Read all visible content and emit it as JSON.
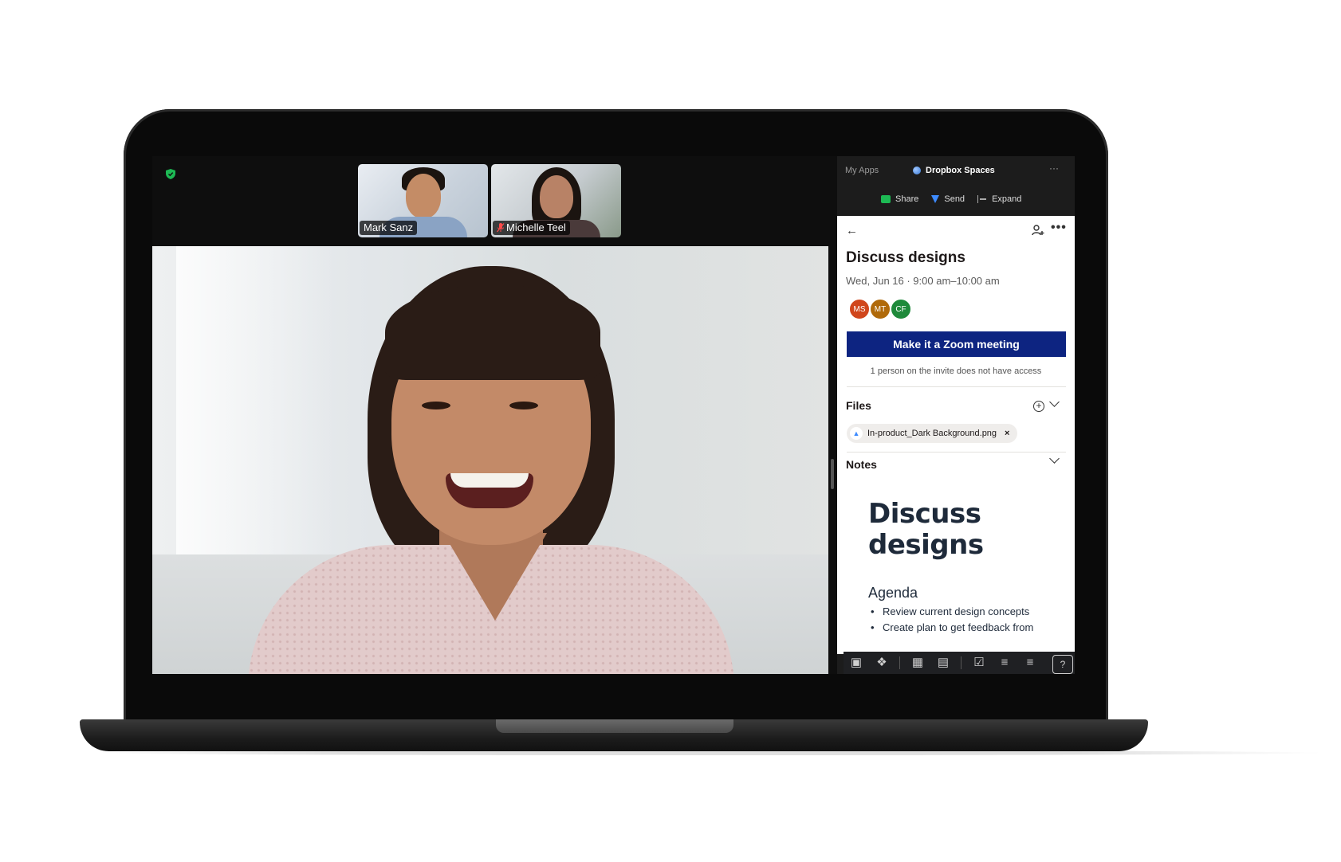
{
  "meeting": {
    "participants": [
      {
        "name": "Mark Sanz",
        "muted": false
      },
      {
        "name": "Michelle Teel",
        "muted": true
      }
    ]
  },
  "side_panel": {
    "header": {
      "my_apps": "My Apps",
      "app_title": "Dropbox Spaces",
      "more": "···"
    },
    "actions": {
      "share": "Share",
      "send": "Send",
      "expand": "Expand"
    },
    "event": {
      "title": "Discuss designs",
      "time": "Wed, Jun 16 · 9:00 am–10:00 am",
      "avatars": [
        {
          "initials": "MS",
          "color": "#d0461c"
        },
        {
          "initials": "MT",
          "color": "#b06a0a"
        },
        {
          "initials": "CF",
          "color": "#1f8a3b"
        }
      ],
      "zoom_button": "Make it a Zoom meeting",
      "access_note": "1 person on the invite does not have access"
    },
    "files": {
      "label": "Files",
      "items": [
        "In-product_Dark Background.png"
      ]
    },
    "notes": {
      "label": "Notes",
      "title_line1": "Discuss",
      "title_line2": "designs",
      "agenda_label": "Agenda",
      "agenda_items": [
        "Review current design concepts",
        "Create plan to get feedback from"
      ]
    },
    "toolbar_icons": [
      "new-space-icon",
      "dropbox-icon",
      "table-icon",
      "calendar-icon",
      "checkbox-icon",
      "bullet-list-icon",
      "numbered-list-icon",
      "help-icon"
    ]
  },
  "colors": {
    "zoom_button": "#0d2481",
    "security": "#1db954"
  }
}
